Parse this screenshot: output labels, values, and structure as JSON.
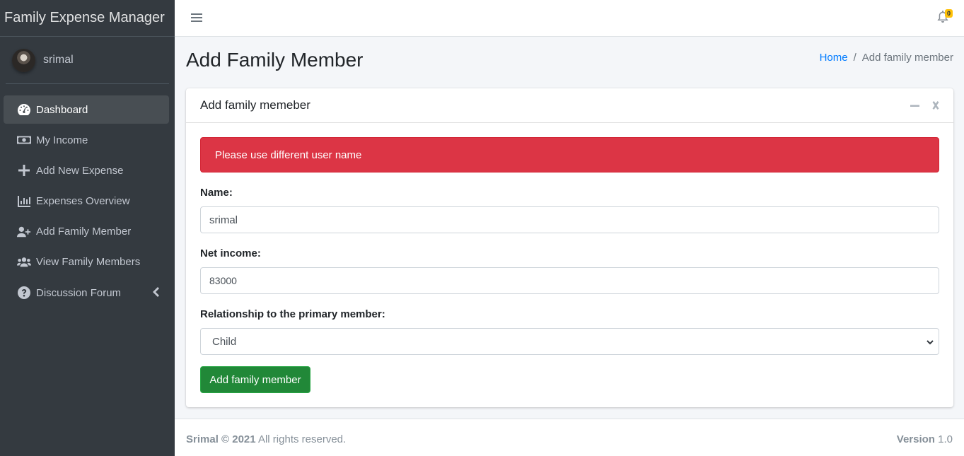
{
  "brand": {
    "title": "Family Expense Manager"
  },
  "user": {
    "name": "srimal"
  },
  "sidebar": {
    "items": [
      {
        "label": "Dashboard",
        "icon": "tachometer-icon",
        "active": true
      },
      {
        "label": "My Income",
        "icon": "money-bill-icon"
      },
      {
        "label": "Add New Expense",
        "icon": "plus-icon"
      },
      {
        "label": "Expenses Overview",
        "icon": "chart-bar-icon"
      },
      {
        "label": "Add Family Member",
        "icon": "user-plus-icon"
      },
      {
        "label": "View Family Members",
        "icon": "users-icon"
      },
      {
        "label": "Discussion Forum",
        "icon": "question-circle-icon",
        "has_submenu": true
      }
    ]
  },
  "topbar": {
    "notification_count": "0"
  },
  "page": {
    "title": "Add Family Member",
    "breadcrumb": {
      "home": "Home",
      "separator": "/",
      "current": "Add family member"
    }
  },
  "card": {
    "title": "Add family memeber",
    "alert": "Please use different user name",
    "form": {
      "name_label": "Name:",
      "name_value": "srimal",
      "income_label": "Net income:",
      "income_value": "83000",
      "relationship_label": "Relationship to the primary member:",
      "relationship_value": "Child",
      "submit_label": "Add family member"
    }
  },
  "footer": {
    "copyright": "Srimal © 2021",
    "rights": "All rights reserved.",
    "version_label": "Version",
    "version_value": "1.0"
  },
  "colors": {
    "sidebar_bg": "#343a40",
    "alert_danger": "#dc3545",
    "button_success": "#218838",
    "link": "#007bff",
    "badge_warning": "#ffc107"
  }
}
